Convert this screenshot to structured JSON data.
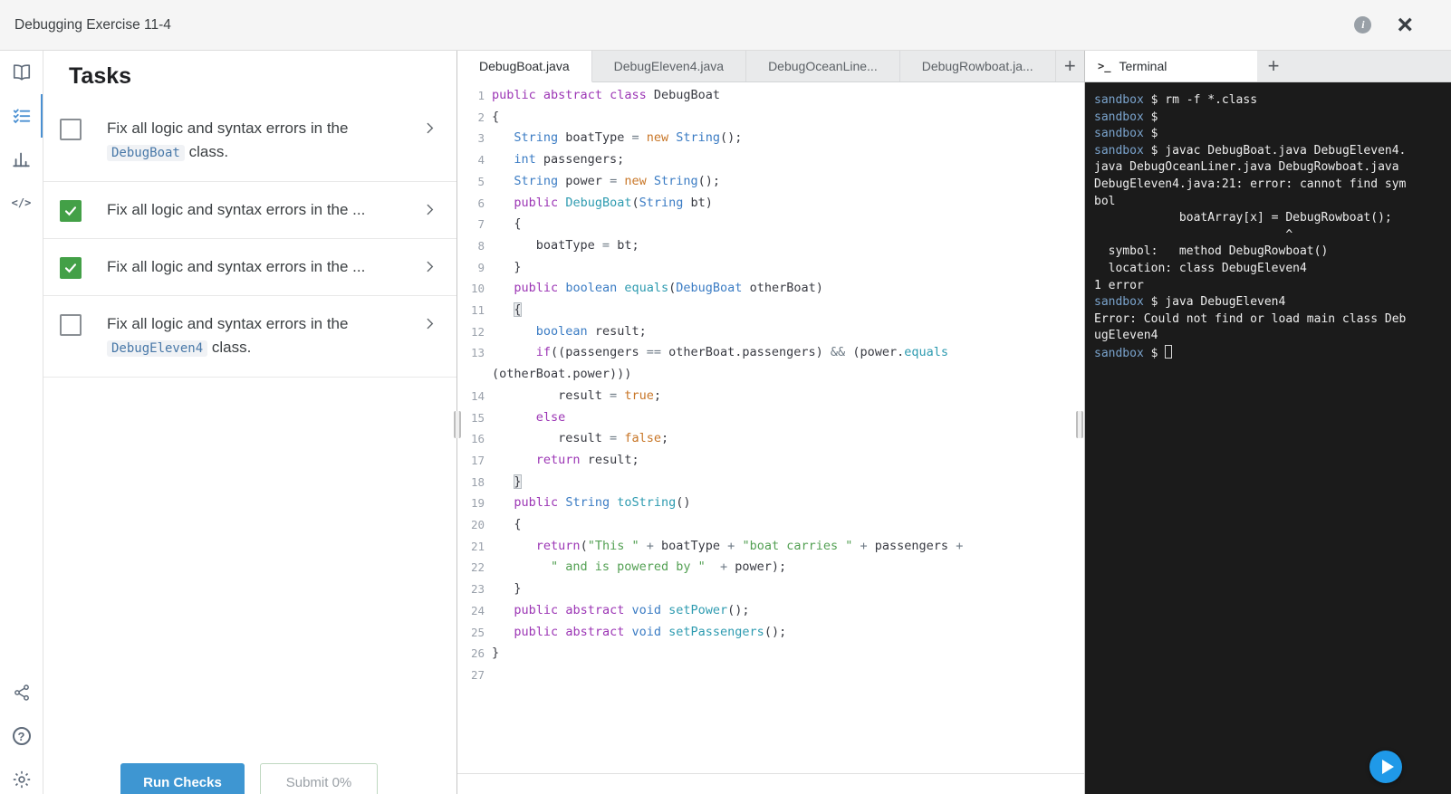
{
  "top_bar": {
    "title": "Debugging Exercise 11-4"
  },
  "icons": {
    "close": "×",
    "info": "i",
    "help": "?",
    "code_rail": "</>",
    "plus": "+",
    "terminal_prompt": ">_"
  },
  "tasks": {
    "title": "Tasks",
    "items": [
      {
        "checked": false,
        "parts": [
          {
            "t": "text",
            "v": "Fix all logic and syntax errors in the "
          },
          {
            "t": "code",
            "v": "DebugBoat"
          },
          {
            "t": "text",
            "v": " class."
          }
        ]
      },
      {
        "checked": true,
        "parts": [
          {
            "t": "text",
            "v": "Fix all logic and syntax errors in the ..."
          }
        ]
      },
      {
        "checked": true,
        "parts": [
          {
            "t": "text",
            "v": "Fix all logic and syntax errors in the ..."
          }
        ]
      },
      {
        "checked": false,
        "parts": [
          {
            "t": "text",
            "v": "Fix all logic and syntax errors in the "
          },
          {
            "t": "code",
            "v": "DebugEleven4"
          },
          {
            "t": "text",
            "v": " class."
          }
        ]
      }
    ],
    "run_checks_label": "Run Checks",
    "submit_label": "Submit 0%"
  },
  "editor": {
    "tabs": [
      {
        "label": "DebugBoat.java",
        "active": true
      },
      {
        "label": "DebugEleven4.java",
        "active": false
      },
      {
        "label": "DebugOceanLine...",
        "active": false
      },
      {
        "label": "DebugRowboat.ja...",
        "active": false
      }
    ],
    "lines": [
      {
        "n": "1",
        "t": [
          [
            "k",
            "public"
          ],
          [
            "p",
            " "
          ],
          [
            "k",
            "abstract"
          ],
          [
            "p",
            " "
          ],
          [
            "k",
            "class"
          ],
          [
            "p",
            " DebugBoat"
          ]
        ]
      },
      {
        "n": "2",
        "t": [
          [
            "p",
            "{"
          ]
        ]
      },
      {
        "n": "3",
        "t": [
          [
            "p",
            "   "
          ],
          [
            "t",
            "String"
          ],
          [
            "p",
            " boatType "
          ],
          [
            "o",
            "="
          ],
          [
            "p",
            " "
          ],
          [
            "l",
            "new"
          ],
          [
            "p",
            " "
          ],
          [
            "t",
            "String"
          ],
          [
            "p",
            "();"
          ]
        ]
      },
      {
        "n": "4",
        "t": [
          [
            "p",
            "   "
          ],
          [
            "t",
            "int"
          ],
          [
            "p",
            " passengers;"
          ]
        ]
      },
      {
        "n": "5",
        "t": [
          [
            "p",
            "   "
          ],
          [
            "t",
            "String"
          ],
          [
            "p",
            " power "
          ],
          [
            "o",
            "="
          ],
          [
            "p",
            " "
          ],
          [
            "l",
            "new"
          ],
          [
            "p",
            " "
          ],
          [
            "t",
            "String"
          ],
          [
            "p",
            "();"
          ]
        ]
      },
      {
        "n": "6",
        "t": [
          [
            "p",
            "   "
          ],
          [
            "k",
            "public"
          ],
          [
            "p",
            " "
          ],
          [
            "m",
            "DebugBoat"
          ],
          [
            "p",
            "("
          ],
          [
            "t",
            "String"
          ],
          [
            "p",
            " bt)"
          ]
        ]
      },
      {
        "n": "7",
        "t": [
          [
            "p",
            "   {"
          ]
        ]
      },
      {
        "n": "8",
        "t": [
          [
            "p",
            "      boatType "
          ],
          [
            "o",
            "="
          ],
          [
            "p",
            " bt;"
          ]
        ]
      },
      {
        "n": "9",
        "t": [
          [
            "p",
            "   }"
          ]
        ]
      },
      {
        "n": "10",
        "t": [
          [
            "p",
            "   "
          ],
          [
            "k",
            "public"
          ],
          [
            "p",
            " "
          ],
          [
            "t",
            "boolean"
          ],
          [
            "p",
            " "
          ],
          [
            "m",
            "equals"
          ],
          [
            "p",
            "("
          ],
          [
            "t",
            "DebugBoat"
          ],
          [
            "p",
            " otherBoat)"
          ]
        ]
      },
      {
        "n": "11",
        "t": [
          [
            "p",
            "   "
          ],
          [
            "bm",
            "{"
          ]
        ]
      },
      {
        "n": "12",
        "t": [
          [
            "p",
            "      "
          ],
          [
            "t",
            "boolean"
          ],
          [
            "p",
            " result;"
          ]
        ]
      },
      {
        "n": "13",
        "t": [
          [
            "p",
            "      "
          ],
          [
            "k",
            "if"
          ],
          [
            "p",
            "((passengers "
          ],
          [
            "o",
            "=="
          ],
          [
            "p",
            " otherBoat.passengers) "
          ],
          [
            "o",
            "&&"
          ],
          [
            "p",
            " (power."
          ],
          [
            "m",
            "equals"
          ]
        ]
      },
      {
        "n": "",
        "t": [
          [
            "p",
            "(otherBoat.power)))"
          ]
        ]
      },
      {
        "n": "14",
        "t": [
          [
            "p",
            "         result "
          ],
          [
            "o",
            "="
          ],
          [
            "p",
            " "
          ],
          [
            "l",
            "true"
          ],
          [
            "p",
            ";"
          ]
        ]
      },
      {
        "n": "15",
        "t": [
          [
            "p",
            "      "
          ],
          [
            "k",
            "else"
          ]
        ]
      },
      {
        "n": "16",
        "t": [
          [
            "p",
            "         result "
          ],
          [
            "o",
            "="
          ],
          [
            "p",
            " "
          ],
          [
            "l",
            "false"
          ],
          [
            "p",
            ";"
          ]
        ]
      },
      {
        "n": "17",
        "t": [
          [
            "p",
            "      "
          ],
          [
            "k",
            "return"
          ],
          [
            "p",
            " result;"
          ]
        ]
      },
      {
        "n": "18",
        "t": [
          [
            "p",
            "   "
          ],
          [
            "bm",
            "}"
          ]
        ]
      },
      {
        "n": "19",
        "t": [
          [
            "p",
            "   "
          ],
          [
            "k",
            "public"
          ],
          [
            "p",
            " "
          ],
          [
            "t",
            "String"
          ],
          [
            "p",
            " "
          ],
          [
            "m",
            "toString"
          ],
          [
            "p",
            "()"
          ]
        ]
      },
      {
        "n": "20",
        "t": [
          [
            "p",
            "   {"
          ]
        ]
      },
      {
        "n": "21",
        "t": [
          [
            "p",
            "      "
          ],
          [
            "k",
            "return"
          ],
          [
            "p",
            "("
          ],
          [
            "s",
            "\"This \""
          ],
          [
            "p",
            " "
          ],
          [
            "o",
            "+"
          ],
          [
            "p",
            " boatType "
          ],
          [
            "o",
            "+"
          ],
          [
            "p",
            " "
          ],
          [
            "s",
            "\"boat carries \""
          ],
          [
            "p",
            " "
          ],
          [
            "o",
            "+"
          ],
          [
            "p",
            " passengers "
          ],
          [
            "o",
            "+"
          ]
        ]
      },
      {
        "n": "22",
        "t": [
          [
            "p",
            "        "
          ],
          [
            "s",
            "\" and is powered by \""
          ],
          [
            "p",
            "  "
          ],
          [
            "o",
            "+"
          ],
          [
            "p",
            " power);"
          ]
        ]
      },
      {
        "n": "23",
        "t": [
          [
            "p",
            "   }"
          ]
        ]
      },
      {
        "n": "24",
        "t": [
          [
            "p",
            "   "
          ],
          [
            "k",
            "public"
          ],
          [
            "p",
            " "
          ],
          [
            "k",
            "abstract"
          ],
          [
            "p",
            " "
          ],
          [
            "t",
            "void"
          ],
          [
            "p",
            " "
          ],
          [
            "m",
            "setPower"
          ],
          [
            "p",
            "();"
          ]
        ]
      },
      {
        "n": "25",
        "t": [
          [
            "p",
            "   "
          ],
          [
            "k",
            "public"
          ],
          [
            "p",
            " "
          ],
          [
            "k",
            "abstract"
          ],
          [
            "p",
            " "
          ],
          [
            "t",
            "void"
          ],
          [
            "p",
            " "
          ],
          [
            "m",
            "setPassengers"
          ],
          [
            "p",
            "();"
          ]
        ]
      },
      {
        "n": "26",
        "t": [
          [
            "p",
            "}"
          ]
        ]
      },
      {
        "n": "27",
        "t": []
      }
    ]
  },
  "terminal": {
    "tab_label": "Terminal",
    "lines": [
      {
        "t": [
          [
            "sb",
            "sandbox"
          ],
          [
            "pl",
            " $ rm -f *.class"
          ]
        ]
      },
      {
        "t": [
          [
            "sb",
            "sandbox"
          ],
          [
            "pl",
            " $"
          ]
        ]
      },
      {
        "t": [
          [
            "sb",
            "sandbox"
          ],
          [
            "pl",
            " $"
          ]
        ]
      },
      {
        "t": [
          [
            "sb",
            "sandbox"
          ],
          [
            "pl",
            " $ javac DebugBoat.java DebugEleven4."
          ]
        ]
      },
      {
        "t": [
          [
            "pl",
            "java DebugOceanLiner.java DebugRowboat.java"
          ]
        ]
      },
      {
        "t": [
          [
            "pl",
            "DebugEleven4.java:21: error: cannot find sym"
          ]
        ]
      },
      {
        "t": [
          [
            "pl",
            "bol"
          ]
        ]
      },
      {
        "t": [
          [
            "pl",
            "            boatArray[x] = DebugRowboat();"
          ]
        ]
      },
      {
        "t": [
          [
            "pl",
            "                           ^"
          ]
        ]
      },
      {
        "t": [
          [
            "pl",
            "  symbol:   method DebugRowboat()"
          ]
        ]
      },
      {
        "t": [
          [
            "pl",
            "  location: class DebugEleven4"
          ]
        ]
      },
      {
        "t": [
          [
            "pl",
            "1 error"
          ]
        ]
      },
      {
        "t": [
          [
            "sb",
            "sandbox"
          ],
          [
            "pl",
            " $ java DebugEleven4"
          ]
        ]
      },
      {
        "t": [
          [
            "pl",
            "Error: Could not find or load main class Deb"
          ]
        ]
      },
      {
        "t": [
          [
            "pl",
            "ugEleven4"
          ]
        ]
      },
      {
        "t": [
          [
            "sb",
            "sandbox"
          ],
          [
            "pl",
            " $ "
          ],
          [
            "cur",
            ""
          ]
        ]
      }
    ]
  }
}
